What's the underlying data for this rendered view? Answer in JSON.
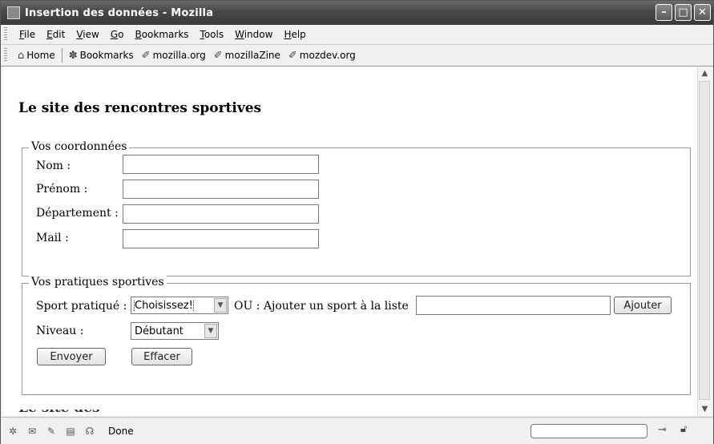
{
  "window": {
    "title": "Insertion des données - Mozilla"
  },
  "menu": [
    "File",
    "Edit",
    "View",
    "Go",
    "Bookmarks",
    "Tools",
    "Window",
    "Help"
  ],
  "bookmarks": [
    {
      "label": "Home",
      "icon": "home-icon"
    },
    {
      "label": "Bookmarks",
      "icon": "bookmarks-icon"
    },
    {
      "label": "mozilla.org",
      "icon": "bookmark-link-icon"
    },
    {
      "label": "mozillaZine",
      "icon": "bookmark-link-icon"
    },
    {
      "label": "mozdev.org",
      "icon": "bookmark-link-icon"
    }
  ],
  "page": {
    "heading": "Le site des rencontres sportives",
    "contact": {
      "legend": "Vos coordonnées",
      "nom_label": "Nom :",
      "prenom_label": "Prénom :",
      "departement_label": "Département :",
      "mail_label": "Mail :"
    },
    "sports": {
      "legend": "Vos pratiques sportives",
      "sport_label": "Sport pratiqué :",
      "sport_selected": "Choisissez!",
      "ou_label": "OU : Ajouter un sport à la liste",
      "ajouter_button": "Ajouter",
      "niveau_label": "Niveau :",
      "niveau_selected": "Débutant",
      "envoyer_button": "Envoyer",
      "effacer_button": "Effacer"
    }
  },
  "status": {
    "text": "Done"
  }
}
